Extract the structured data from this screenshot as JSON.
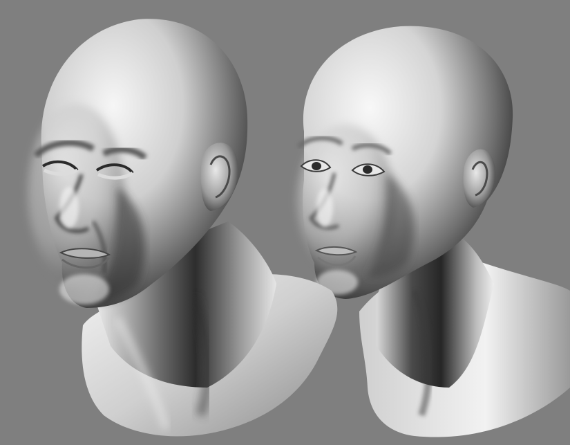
{
  "scene": {
    "background_color": "#7f7f7f",
    "clay_light": "#f4f4f4",
    "clay_mid": "#a9a9a9",
    "clay_dark": "#2a2a2a",
    "subjects": [
      {
        "id": "male-head",
        "eyes": "closed"
      },
      {
        "id": "female-head",
        "eyes": "open"
      }
    ]
  }
}
